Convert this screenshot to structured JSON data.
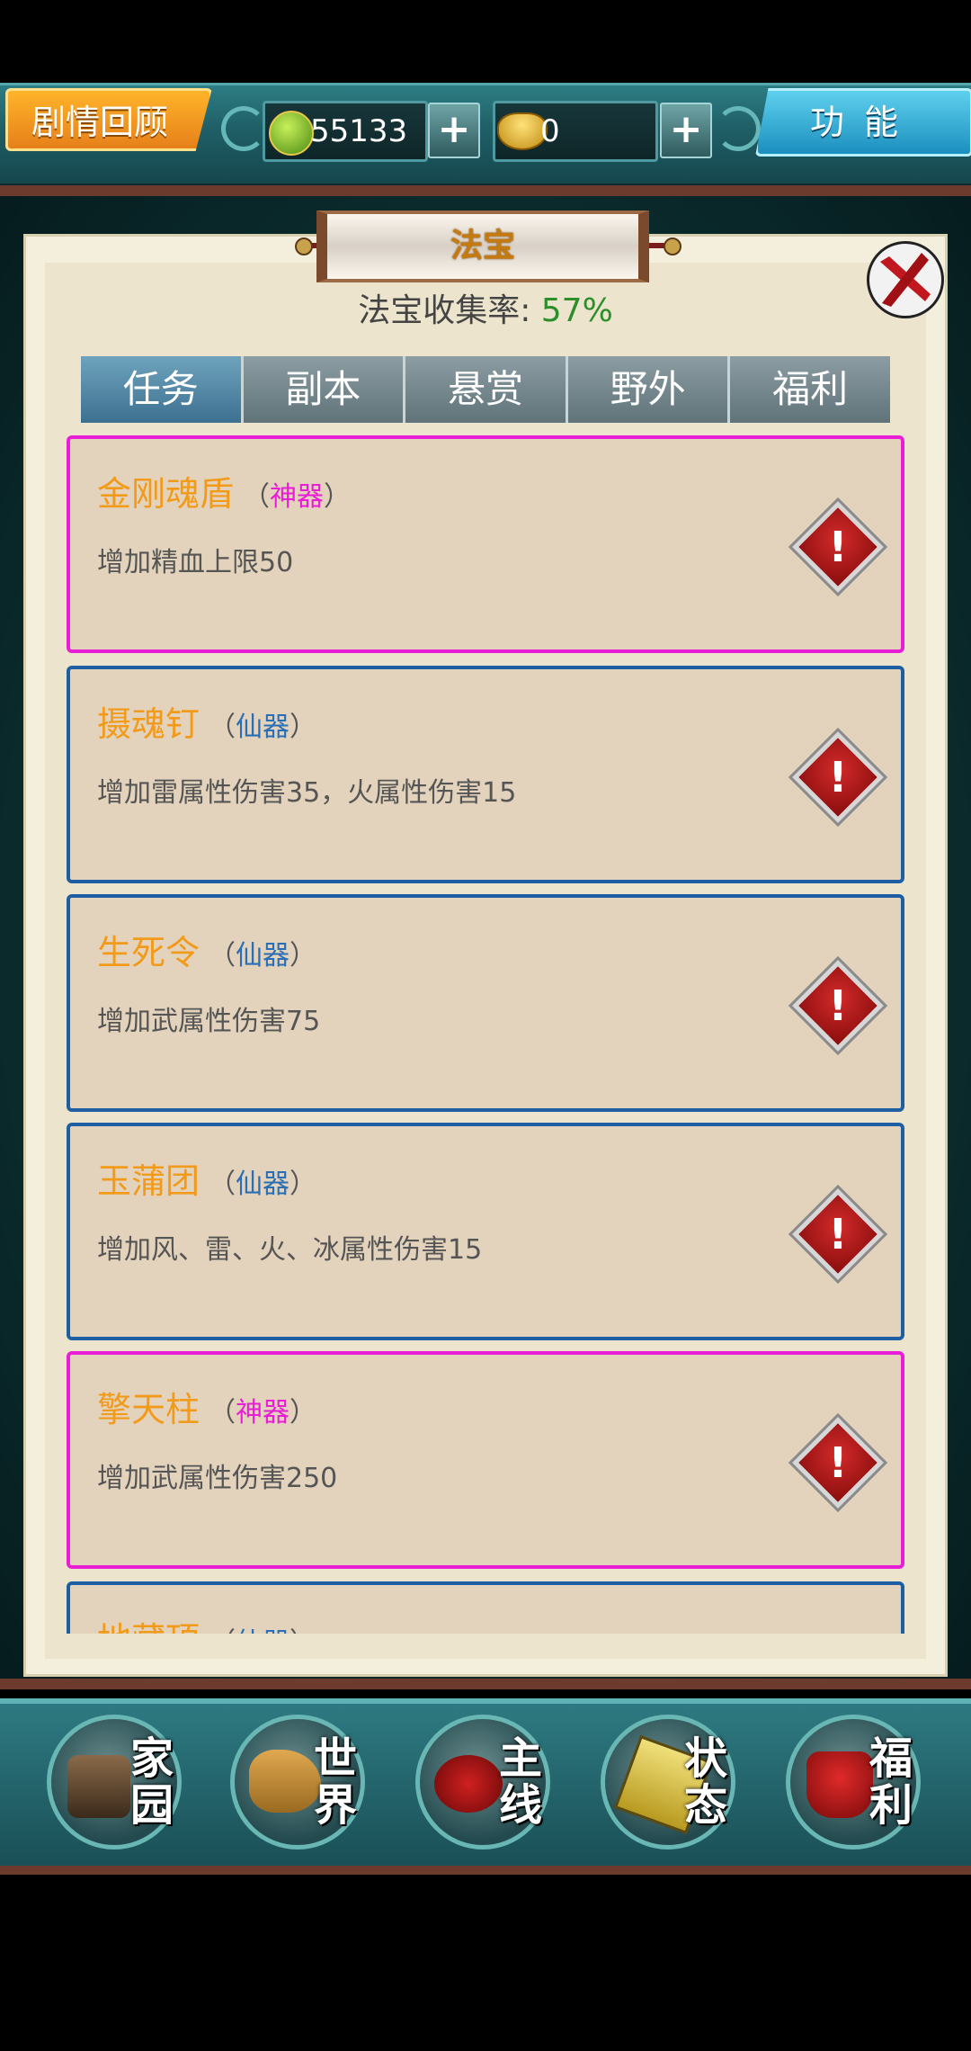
{
  "header": {
    "story_button": "剧情回顾",
    "jade_amount": "55133",
    "gold_amount": "0",
    "plus_label": "+",
    "function_button": "功能"
  },
  "panel": {
    "title": "法宝",
    "collection_rate_label": "法宝收集率: ",
    "collection_rate_value": "57%"
  },
  "tabs": [
    "任务",
    "副本",
    "悬赏",
    "野外",
    "福利"
  ],
  "active_tab": 0,
  "items": [
    {
      "name": "金刚魂盾",
      "grade": "神器",
      "desc": "增加精血上限50"
    },
    {
      "name": "摄魂钉",
      "grade": "仙器",
      "desc": "增加雷属性伤害35，火属性伤害15"
    },
    {
      "name": "生死令",
      "grade": "仙器",
      "desc": "增加武属性伤害75"
    },
    {
      "name": "玉蒲团",
      "grade": "仙器",
      "desc": "增加风、雷、火、冰属性伤害15"
    },
    {
      "name": "擎天柱",
      "grade": "神器",
      "desc": "增加武属性伤害250"
    },
    {
      "name": "地藏顶",
      "grade": "仙器",
      "desc": ""
    }
  ],
  "grade_paren_open": "（",
  "grade_paren_close": "）",
  "alert_glyph": "!",
  "colors": {
    "divine_border": "#e81ed6",
    "immortal_border": "#1e5fa3",
    "item_name": "#f29a1a",
    "rate_value": "#2c8f2c"
  },
  "bottom_nav": [
    "家园",
    "世界",
    "主线",
    "状态",
    "福利"
  ]
}
